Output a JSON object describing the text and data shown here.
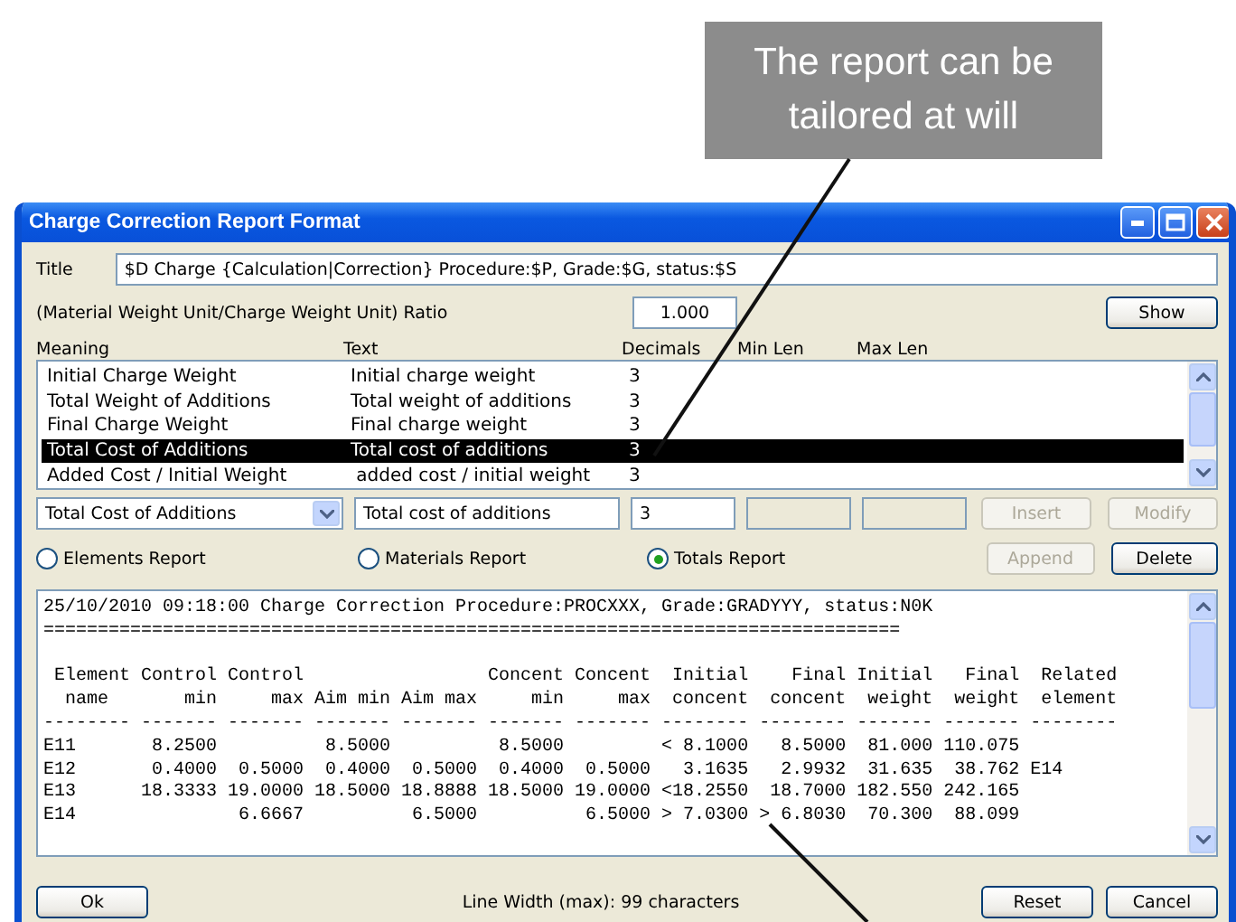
{
  "callout": {
    "text": "The report can be tailored at will"
  },
  "window": {
    "title": "Charge Correction Report Format"
  },
  "title_field": {
    "label": "Title",
    "value": "$D Charge {Calculation|Correction} Procedure:$P, Grade:$G, status:$S"
  },
  "ratio_field": {
    "label": "(Material Weight Unit/Charge Weight Unit) Ratio",
    "value": "1.000"
  },
  "show_button": {
    "label": "Show"
  },
  "list": {
    "columns": [
      "Meaning",
      "Text",
      "Decimals",
      "Min Len",
      "Max Len"
    ],
    "rows": [
      {
        "meaning": "Initial Charge Weight",
        "text": "Initial charge weight",
        "decimals": "3",
        "selected": false
      },
      {
        "meaning": "Total Weight of Additions",
        "text": "Total weight of additions",
        "decimals": "3",
        "selected": false
      },
      {
        "meaning": "Final Charge Weight",
        "text": "Final charge weight",
        "decimals": "3",
        "selected": false
      },
      {
        "meaning": "Total Cost of Additions",
        "text": "Total cost of additions",
        "decimals": "3",
        "selected": true
      },
      {
        "meaning": "Added Cost / Initial Weight",
        "text": " added cost / initial weight",
        "decimals": "3",
        "selected": false
      }
    ]
  },
  "editor": {
    "meaning": "Total Cost of Additions",
    "text": "Total cost of additions",
    "decimals": "3"
  },
  "editor_buttons": [
    {
      "label": "Insert",
      "disabled": true
    },
    {
      "label": "Modify",
      "disabled": true
    }
  ],
  "report_types": [
    {
      "label": "Elements Report",
      "selected": false
    },
    {
      "label": "Materials Report",
      "selected": false
    },
    {
      "label": "Totals Report",
      "selected": true
    }
  ],
  "report_buttons": [
    {
      "label": "Append",
      "disabled": true
    },
    {
      "label": "Delete",
      "disabled": false
    }
  ],
  "report_heading": [
    "25/10/2010 09:18:00 Charge Correction Procedure:PROCXXX, Grade:GRADYYY, status:N0K",
    "==============================================================================="
  ],
  "report_lines": [
    " Element Control Control                 Concent Concent  Initial    Final Initial   Final  Related",
    "  name       min     max Aim min Aim max     min     max  concent  concent  weight  weight  element",
    "-------- ------- ------- ------- ------- ------- ------- -------- -------- ------- ------- --------",
    "E11       8.2500          8.5000          8.5000         < 8.1000   8.5000  81.000 110.075",
    "E12       0.4000  0.5000  0.4000  0.5000  0.4000  0.5000   3.1635   2.9932  31.635  38.762 E14",
    "E13      18.3333 19.0000 18.5000 18.8888 18.5000 19.0000 <18.2550  18.7000 182.550 242.165",
    "E14               6.6667          6.5000          6.5000 > 7.0300 > 6.8030  70.300  88.099"
  ],
  "footer": {
    "ok": "Ok",
    "line_width": "Line Width (max): 99 characters",
    "reset": "Reset",
    "cancel": "Cancel"
  }
}
